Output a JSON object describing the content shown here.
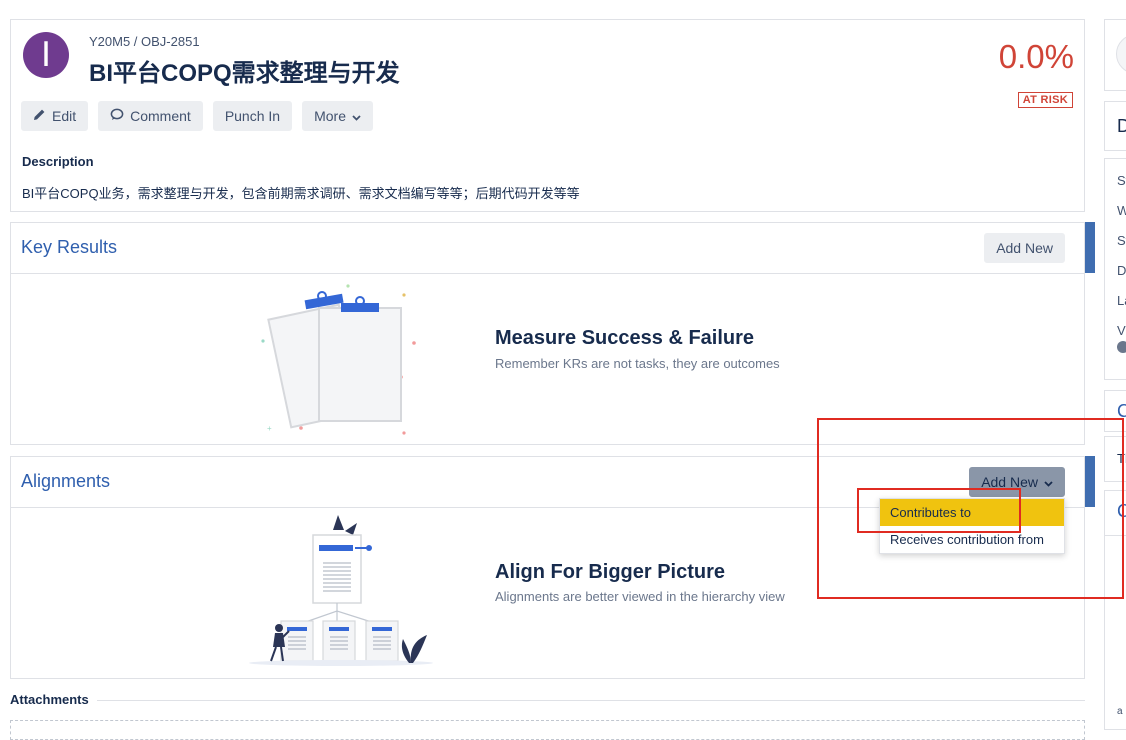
{
  "objective": {
    "avatar_letter": "I",
    "breadcrumb": "Y20M5 / OBJ-2851",
    "title": "BI平台COPQ需求整理与开发",
    "progress": "0.0%",
    "risk_badge": "AT RISK",
    "edit": "Edit",
    "comment": "Comment",
    "punch_in": "Punch In",
    "more": "More",
    "description_label": "Description",
    "description": "BI平台COPQ业务，需求整理与开发，包含前期需求调研、需求文档编写等等；后期代码开发等等"
  },
  "key_results": {
    "title": "Key Results",
    "add_new": "Add New",
    "empty_title": "Measure Success & Failure",
    "empty_sub": "Remember KRs are not tasks, they are outcomes"
  },
  "alignments": {
    "title": "Alignments",
    "add_new": "Add New",
    "empty_title": "Align For Bigger Picture",
    "empty_sub": "Alignments are better viewed in the hierarchy view",
    "menu": [
      "Contributes to",
      "Receives contribution from"
    ]
  },
  "attachments": {
    "title": "Attachments"
  },
  "sidebar": {
    "card2_letter": "D",
    "fields": [
      "St",
      "W",
      "St",
      "D",
      "La",
      "V"
    ],
    "card4_letter": "C",
    "card5_letter": "Tl",
    "card6_letter": "C",
    "bottom_text": "a"
  },
  "colors": {
    "accent": "#2f5fae",
    "risk": "#d04437",
    "highlight": "#f0c30f",
    "annotation": "#e02b21"
  }
}
